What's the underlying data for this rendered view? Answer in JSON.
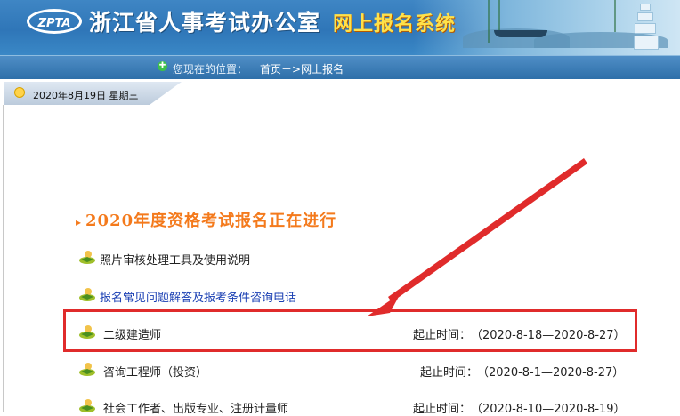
{
  "banner": {
    "logo_text": "ZPTA",
    "org_name": "浙江省人事考试办公室",
    "system_name": "网上报名系统"
  },
  "nav": {
    "location_label": "您现在的位置：",
    "breadcrumb": "首页－>网上报名"
  },
  "datebar": {
    "date": "2020年8月19日 星期三"
  },
  "main": {
    "heading": "2020年度资格考试报名正在进行",
    "items": [
      {
        "label": "照片审核处理工具及使用说明",
        "time_label": "",
        "time_value": ""
      },
      {
        "label": "报名常见问题解答及报考条件咨询电话",
        "time_label": "",
        "time_value": ""
      },
      {
        "label": "二级建造师",
        "time_label": "起止时间：",
        "time_value": "（2020-8-18—2020-8-27）"
      },
      {
        "label": "咨询工程师（投资）",
        "time_label": "起止时间：",
        "time_value": "（2020-8-1—2020-8-27）"
      },
      {
        "label": "社会工作者、出版专业、注册计量师",
        "time_label": "起止时间：",
        "time_value": "（2020-8-10—2020-8-19）"
      }
    ]
  },
  "colors": {
    "banner_blue": "#2f76b8",
    "heading_orange": "#f47a1c",
    "link_blue": "#1a3fb3",
    "annotation_red": "#e02b2b"
  },
  "icons": {
    "logo": "zpta-logo-icon",
    "location": "location-icon",
    "date": "sun-icon",
    "item": "boy-reading-icon"
  }
}
